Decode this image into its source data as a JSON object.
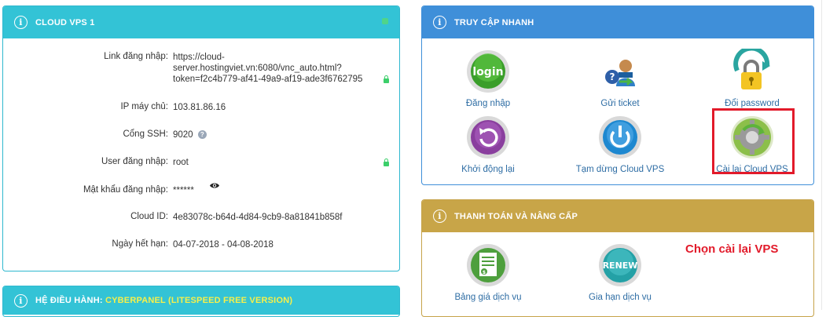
{
  "vps_panel": {
    "title": "CLOUD VPS 1",
    "rows": [
      {
        "label": "Link đăng nhập:",
        "value_lines": [
          "https://cloud-",
          "server.hostingviet.vn:6080/vnc_auto.html?",
          "token=f2c4b779-af41-49a9-af19-ade3f6762795"
        ]
      },
      {
        "label": "IP máy chủ:",
        "value": "103.81.86.16"
      },
      {
        "label": "Cổng SSH:",
        "value": "9020",
        "help": "?"
      },
      {
        "label": "User đăng nhập:",
        "value": "root"
      },
      {
        "label": "Mật khẩu đăng nhập:",
        "value": "******"
      },
      {
        "label": "Cloud ID:",
        "value": "4e83078c-b64d-4d84-9cb9-8a81841b858f"
      },
      {
        "label": "Ngày hết hạn:",
        "value": "04-07-2018 - 04-08-2018"
      }
    ]
  },
  "os_panel": {
    "title_prefix": "HỆ ĐIỀU HÀNH: ",
    "title_value": "CYBERPANEL (LITESPEED FREE VERSION)"
  },
  "quick_access": {
    "title": "TRUY CẬP NHANH",
    "items": [
      {
        "label": "Đăng nhập",
        "icon": "login-icon",
        "icon_text": "login"
      },
      {
        "label": "Gửi ticket",
        "icon": "ticket-icon"
      },
      {
        "label": "Đổi password",
        "icon": "lock-refresh-icon"
      },
      {
        "label": "Khởi động lại",
        "icon": "restart-icon"
      },
      {
        "label": "Tạm dừng Cloud VPS",
        "icon": "power-icon"
      },
      {
        "label": "Cài lại Cloud VPS",
        "icon": "reinstall-gear-icon"
      }
    ]
  },
  "payment_panel": {
    "title": "THANH TOÁN VÀ NÂNG CẤP",
    "items": [
      {
        "label": "Bảng giá dịch vụ",
        "icon": "price-list-icon"
      },
      {
        "label": "Gia hạn dịch vụ",
        "icon": "renew-icon",
        "icon_text": "RENEW"
      }
    ]
  },
  "annotation": {
    "text": "Chọn cài lại VPS",
    "color": "#e21a2a"
  },
  "colors": {
    "vps_header": "#33c3d6",
    "quick_header": "#3f8fd9",
    "payment_header": "#c8a548",
    "link": "#2e6da4"
  }
}
